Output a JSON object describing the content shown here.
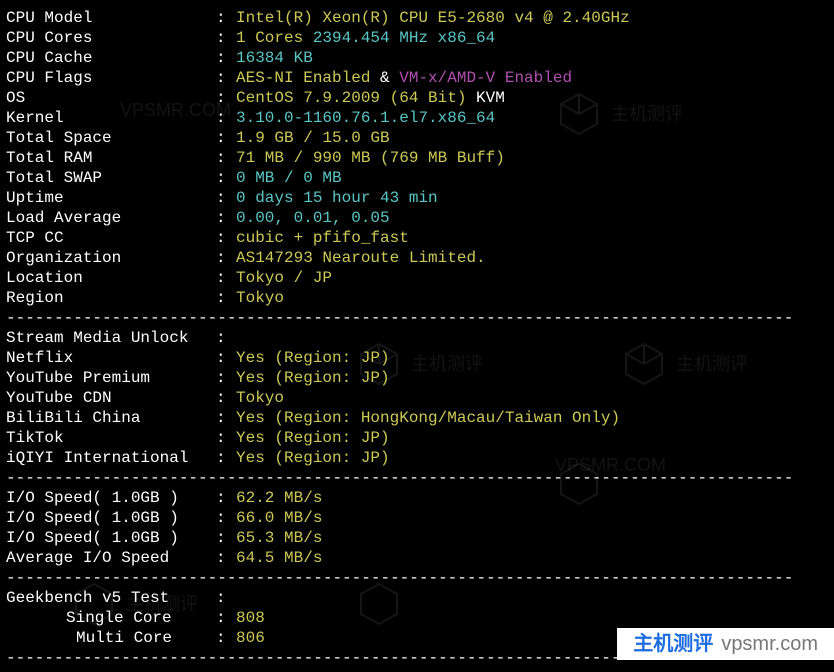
{
  "divider": "----------------------------------------------------------------------------------",
  "specs": [
    {
      "label": "CPU Model",
      "parts": [
        {
          "text": "Intel(R) Xeon(R) CPU E5-2680 v4 @ 2.40GHz",
          "class": "yellow"
        }
      ]
    },
    {
      "label": "CPU Cores",
      "parts": [
        {
          "text": "1 Cores",
          "class": "yellow"
        },
        {
          "text": " 2394.454 MHz x86_64",
          "class": "cyan"
        }
      ]
    },
    {
      "label": "CPU Cache",
      "parts": [
        {
          "text": "16384 KB",
          "class": "cyan"
        }
      ]
    },
    {
      "label": "CPU Flags",
      "parts": [
        {
          "text": "AES-NI Enabled",
          "class": "yellow"
        },
        {
          "text": " & ",
          "class": "white"
        },
        {
          "text": "VM-x/AMD-V Enabled",
          "class": "purple"
        }
      ]
    },
    {
      "label": "OS",
      "parts": [
        {
          "text": "CentOS 7.9.2009 (64 Bit)",
          "class": "yellow"
        },
        {
          "text": " KVM",
          "class": "white"
        }
      ]
    },
    {
      "label": "Kernel",
      "parts": [
        {
          "text": "3.10.0-1160.76.1.el7.x86_64",
          "class": "cyan"
        }
      ]
    },
    {
      "label": "Total Space",
      "parts": [
        {
          "text": "1.9 GB / 15.0 GB",
          "class": "yellow"
        }
      ]
    },
    {
      "label": "Total RAM",
      "parts": [
        {
          "text": "71 MB / 990 MB (769 MB Buff)",
          "class": "yellow"
        }
      ]
    },
    {
      "label": "Total SWAP",
      "parts": [
        {
          "text": "0 MB / 0 MB",
          "class": "cyan"
        }
      ]
    },
    {
      "label": "Uptime",
      "parts": [
        {
          "text": "0 days 15 hour 43 min",
          "class": "cyan"
        }
      ]
    },
    {
      "label": "Load Average",
      "parts": [
        {
          "text": "0.00, 0.01, 0.05",
          "class": "cyan"
        }
      ]
    },
    {
      "label": "TCP CC",
      "parts": [
        {
          "text": "cubic + pfifo_fast",
          "class": "yellow"
        }
      ]
    },
    {
      "label": "Organization",
      "parts": [
        {
          "text": "AS147293 Nearoute Limited.",
          "class": "yellow"
        }
      ]
    },
    {
      "label": "Location",
      "parts": [
        {
          "text": "Tokyo / JP",
          "class": "yellow"
        }
      ]
    },
    {
      "label": "Region",
      "parts": [
        {
          "text": "Tokyo",
          "class": "yellow"
        }
      ]
    }
  ],
  "stream_header": "Stream Media Unlock",
  "stream": [
    {
      "label": "Netflix",
      "parts": [
        {
          "text": "Yes (Region: JP)",
          "class": "yellow"
        }
      ]
    },
    {
      "label": "YouTube Premium",
      "parts": [
        {
          "text": "Yes (Region: JP)",
          "class": "yellow"
        }
      ]
    },
    {
      "label": "YouTube CDN",
      "parts": [
        {
          "text": "Tokyo",
          "class": "yellow"
        }
      ]
    },
    {
      "label": "BiliBili China",
      "parts": [
        {
          "text": "Yes (Region: HongKong/Macau/Taiwan Only)",
          "class": "yellow"
        }
      ]
    },
    {
      "label": "TikTok",
      "parts": [
        {
          "text": "Yes (Region: JP)",
          "class": "yellow"
        }
      ]
    },
    {
      "label": "iQIYI International",
      "parts": [
        {
          "text": "Yes (Region: JP)",
          "class": "yellow"
        }
      ]
    }
  ],
  "iospeed": [
    {
      "label": "I/O Speed( 1.0GB )",
      "parts": [
        {
          "text": "62.2 MB/s",
          "class": "yellow"
        }
      ]
    },
    {
      "label": "I/O Speed( 1.0GB )",
      "parts": [
        {
          "text": "66.0 MB/s",
          "class": "yellow"
        }
      ]
    },
    {
      "label": "I/O Speed( 1.0GB )",
      "parts": [
        {
          "text": "65.3 MB/s",
          "class": "yellow"
        }
      ]
    },
    {
      "label": "Average I/O Speed",
      "parts": [
        {
          "text": "64.5 MB/s",
          "class": "yellow"
        }
      ]
    }
  ],
  "geekbench_header": "Geekbench v5 Test",
  "geekbench": [
    {
      "label": "Single Core",
      "indentClass": "indent-label",
      "parts": [
        {
          "text": "808",
          "class": "yellow"
        }
      ]
    },
    {
      "label": "Multi Core",
      "indentClass": "indent-label2",
      "parts": [
        {
          "text": "806",
          "class": "yellow"
        }
      ]
    }
  ],
  "watermark": {
    "cn": "主机测评",
    "en": "vpsmr.com"
  }
}
